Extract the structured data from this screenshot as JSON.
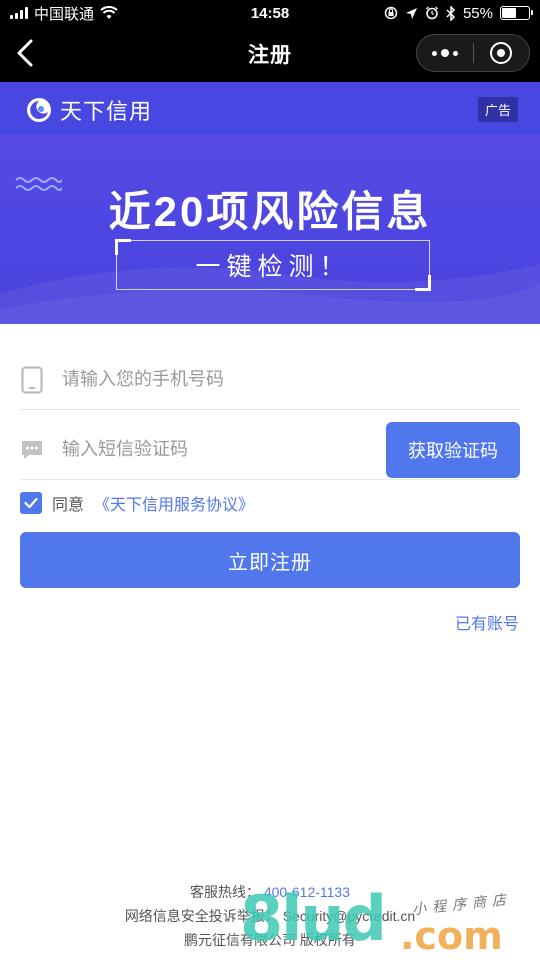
{
  "status_bar": {
    "carrier": "中国联通",
    "time": "14:58",
    "battery": "55%",
    "battery_level": 0.55
  },
  "nav": {
    "title": "注册"
  },
  "banner": {
    "brand": "天下信用",
    "ad_label": "广告",
    "headline": "近20项风险信息",
    "subline": "一键检测！"
  },
  "form": {
    "phone_placeholder": "请输入您的手机号码",
    "code_placeholder": "输入短信验证码",
    "get_code_label": "获取验证码",
    "agree_label": "同意",
    "agreement_link": "《天下信用服务协议》",
    "agreed": true,
    "register_label": "立即注册",
    "has_account_label": "已有账号"
  },
  "footer": {
    "hotline_label": "客服热线：",
    "hotline_number": "400-612-1133",
    "report_label": "网络信息安全投诉举报：",
    "report_email": "Security@pycredit.cn",
    "copyright": "鹏元征信有限公司 版权所有"
  },
  "watermark": {
    "main": "8lud",
    "tld": ".com",
    "script": "小程序商店"
  },
  "colors": {
    "primary": "#5177ec",
    "banner": "#5b4be3",
    "watermark_green": "#3ec9b3",
    "watermark_orange": "#f0a848"
  }
}
